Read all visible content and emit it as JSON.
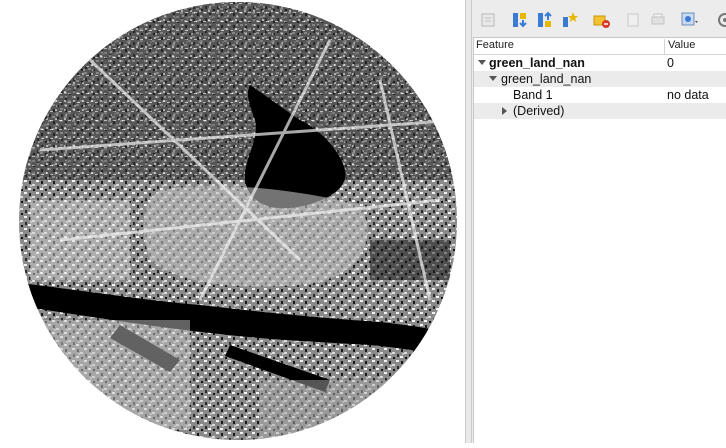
{
  "table": {
    "col_feature": "Feature",
    "col_value": "Value",
    "rows": [
      {
        "label": "green_land_nan",
        "value": "0"
      },
      {
        "label": "green_land_nan",
        "value": ""
      },
      {
        "label": "Band 1",
        "value": "no data"
      },
      {
        "label": "(Derived)",
        "value": ""
      }
    ]
  },
  "toolbar": {
    "icons": [
      "expand-tree-icon",
      "expand-all-icon",
      "collapse-all-icon",
      "expand-new-icon",
      "highlight-feature-icon",
      "copy-feature-icon",
      "print-icon",
      "identify-mode-icon",
      "settings-icon"
    ]
  },
  "map": {
    "image": "raster-layer-green-land-nan"
  },
  "colors": {
    "accent_blue": "#3a7bd5",
    "accent_yellow": "#e6b800",
    "accent_red": "#d43a2a"
  }
}
